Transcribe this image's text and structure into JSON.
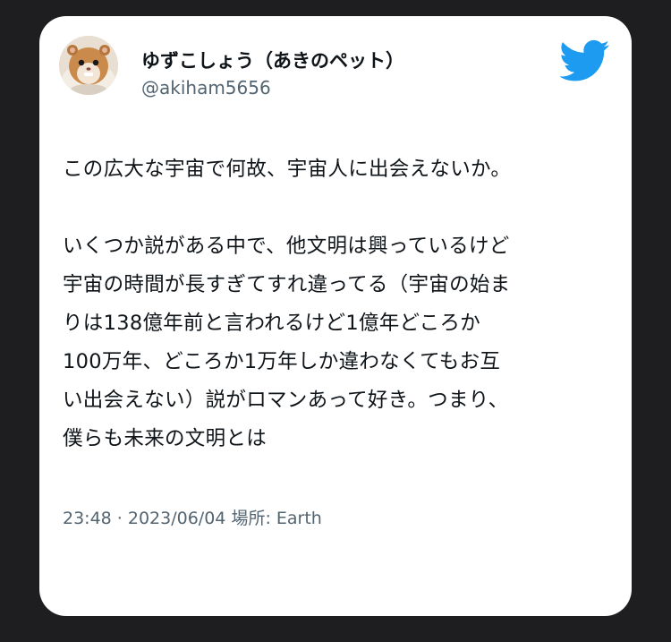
{
  "author": {
    "display_name": "ゆずこしょう（あきのペット）",
    "handle": "@akiham5656",
    "avatar_icon": "hamster-avatar-icon"
  },
  "brand": {
    "logo_icon": "twitter-bird-icon",
    "color": "#1d9bf0"
  },
  "tweet": {
    "lines": [
      "この広大な宇宙で何故、宇宙人に出会えないか。",
      "",
      "いくつか説がある中で、他文明は興っているけど",
      "宇宙の時間が長すぎてすれ違ってる（宇宙の始ま",
      "りは138億年前と言われるけど1億年どころか",
      "100万年、どころか1万年しか違わなくてもお互",
      "い出会えない）説がロマンあって好き。つまり、",
      "僕らも未来の文明とは"
    ],
    "timestamp": "23:48 · 2023/06/04",
    "location_label": "場所:",
    "location": "Earth"
  },
  "colors": {
    "background": "#1e1e20",
    "card": "#ffffff",
    "text": "#0f1419",
    "muted": "#536471"
  }
}
